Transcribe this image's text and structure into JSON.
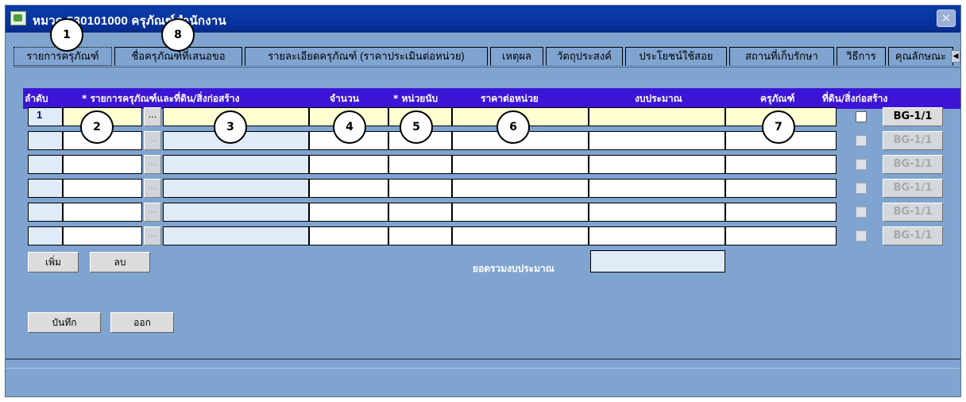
{
  "window": {
    "title": "หมวด 530101000 ครุภัณฑ์สำนักงาน",
    "close_symbol": "✕"
  },
  "tabs": [
    "รายการครุภัณฑ์",
    "ชื่อครุภัณฑ์ที่เสนอขอ",
    "รายละเอียดครุภัณฑ์ (ราคาประเมินต่อหน่วย)",
    "เหตุผล",
    "วัตถุประสงค์",
    "ประโยชน์ใช้สอย",
    "สถานที่เก็บรักษา",
    "วิธีการ",
    "คุณลักษณะ"
  ],
  "tab_scroll_symbol": "◀",
  "columns": {
    "seq": "ลำดับ",
    "item": "* รายการครุภัณฑ์และที่ดิน/สิ่งก่อสร้าง",
    "qty": "จำนวน",
    "unit": "* หน่วยนับ",
    "price": "ราคาต่อหน่วย",
    "budget": "งบประมาณ",
    "asset": "ครุภัณฑ์",
    "land": "ที่ดิน/สิ่งก่อสร้าง"
  },
  "rows": [
    {
      "seq": "1",
      "bg": "BG-1/1",
      "enabled": true
    },
    {
      "seq": "",
      "bg": "BG-1/1",
      "enabled": false
    },
    {
      "seq": "",
      "bg": "BG-1/1",
      "enabled": false
    },
    {
      "seq": "",
      "bg": "BG-1/1",
      "enabled": false
    },
    {
      "seq": "",
      "bg": "BG-1/1",
      "enabled": false
    },
    {
      "seq": "",
      "bg": "BG-1/1",
      "enabled": false
    }
  ],
  "dots_label": "...",
  "buttons": {
    "add": "เพิ่ม",
    "delete": "ลบ",
    "save": "บันทึก",
    "exit": "ออก"
  },
  "total": {
    "label": "ยอดรวมงบประมาณ",
    "value": ""
  },
  "callouts": [
    "1",
    "2",
    "3",
    "4",
    "5",
    "6",
    "7",
    "8"
  ],
  "colors": {
    "header_bar": "#3c14d6",
    "window_bg": "#80a4d0",
    "title_bar": "#0833a0",
    "active_row": "#ffffd2"
  }
}
